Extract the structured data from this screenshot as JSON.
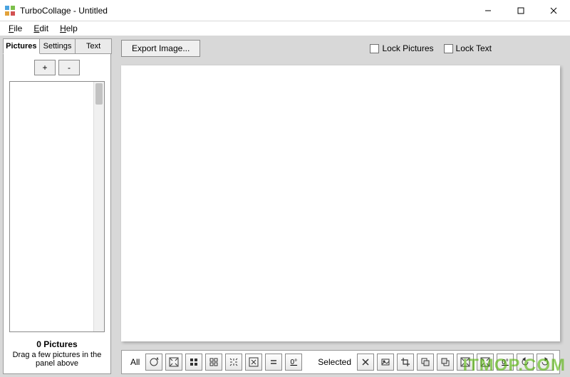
{
  "window": {
    "title": "TurboCollage - Untitled"
  },
  "menu": {
    "file": "File",
    "edit": "Edit",
    "help": "Help"
  },
  "tabs": {
    "pictures": "Pictures",
    "settings": "Settings",
    "text": "Text"
  },
  "sidebar": {
    "add_label": "+",
    "remove_label": "-",
    "count_label": "0 Pictures",
    "hint": "Drag a few pictures in the panel above"
  },
  "toolbar": {
    "export_label": "Export Image...",
    "lock_pictures": "Lock Pictures",
    "lock_text": "Lock Text"
  },
  "bottom": {
    "all_label": "All",
    "selected_label": "Selected",
    "zero_underline": "0°"
  },
  "icons": {
    "rotate_all": "rotate-all-icon",
    "fit": "fit-icon",
    "grid4": "grid-4-icon",
    "grid4b": "grid-4b-icon",
    "arrows_out": "arrows-out-icon",
    "arrows_out2": "arrows-out2-icon",
    "equal": "equal-icon",
    "close": "close-icon",
    "image": "image-icon",
    "crop": "crop-icon",
    "send_back": "send-back-icon",
    "bring_front": "bring-front-icon",
    "fit2": "fit2-icon",
    "fit3": "fit3-icon",
    "rotate_ccw": "rotate-ccw-icon",
    "rotate_cw": "rotate-cw-icon"
  },
  "watermark": "ITMOP.COM"
}
